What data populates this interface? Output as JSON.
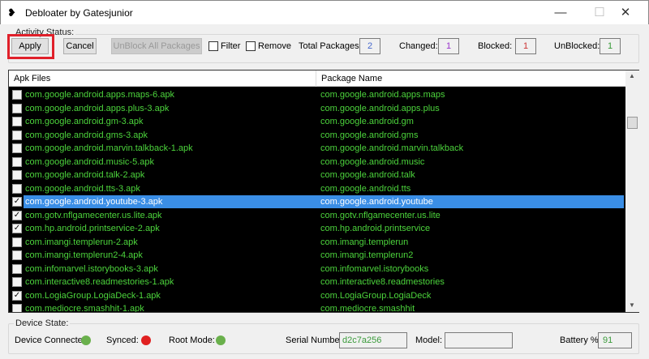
{
  "window": {
    "title": "Debloater by Gatesjunior",
    "minimize": "—",
    "maximize": "☐",
    "close": "✕"
  },
  "activity": {
    "legend": "Activity Status:",
    "apply": "Apply",
    "cancel": "Cancel",
    "unblock_all": "UnBlock All Packages",
    "filter": "Filter",
    "remove": "Remove",
    "filter_checked": false,
    "remove_checked": false,
    "total_label": "Total Packages:",
    "total": "2",
    "changed_label": "Changed:",
    "changed": "1",
    "blocked_label": "Blocked:",
    "blocked": "1",
    "unblocked_label": "UnBlocked:",
    "unblocked": "1"
  },
  "list": {
    "headers": [
      "Apk Files",
      "Package Name"
    ],
    "rows": [
      {
        "apk": "com.google.android.apps.maps-6.apk",
        "pkg": "com.google.android.apps.maps",
        "checked": false
      },
      {
        "apk": "com.google.android.apps.plus-3.apk",
        "pkg": "com.google.android.apps.plus",
        "checked": false
      },
      {
        "apk": "com.google.android.gm-3.apk",
        "pkg": "com.google.android.gm",
        "checked": false
      },
      {
        "apk": "com.google.android.gms-3.apk",
        "pkg": "com.google.android.gms",
        "checked": false
      },
      {
        "apk": "com.google.android.marvin.talkback-1.apk",
        "pkg": "com.google.android.marvin.talkback",
        "checked": false
      },
      {
        "apk": "com.google.android.music-5.apk",
        "pkg": "com.google.android.music",
        "checked": false
      },
      {
        "apk": "com.google.android.talk-2.apk",
        "pkg": "com.google.android.talk",
        "checked": false
      },
      {
        "apk": "com.google.android.tts-3.apk",
        "pkg": "com.google.android.tts",
        "checked": false
      },
      {
        "apk": "com.google.android.youtube-3.apk",
        "pkg": "com.google.android.youtube",
        "checked": true,
        "selected": true
      },
      {
        "apk": "com.gotv.nflgamecenter.us.lite.apk",
        "pkg": "com.gotv.nflgamecenter.us.lite",
        "checked": true
      },
      {
        "apk": "com.hp.android.printservice-2.apk",
        "pkg": "com.hp.android.printservice",
        "checked": true
      },
      {
        "apk": "com.imangi.templerun-2.apk",
        "pkg": "com.imangi.templerun",
        "checked": false
      },
      {
        "apk": "com.imangi.templerun2-4.apk",
        "pkg": "com.imangi.templerun2",
        "checked": false
      },
      {
        "apk": "com.infomarvel.istorybooks-3.apk",
        "pkg": "com.infomarvel.istorybooks",
        "checked": false
      },
      {
        "apk": "com.interactive8.readmestories-1.apk",
        "pkg": "com.interactive8.readmestories",
        "checked": false
      },
      {
        "apk": "com.LogiaGroup.LogiaDeck-1.apk",
        "pkg": "com.LogiaGroup.LogiaDeck",
        "checked": true
      },
      {
        "apk": "com.mediocre.smashhit-1.apk",
        "pkg": "com.mediocre.smashhit",
        "checked": false
      }
    ]
  },
  "device": {
    "legend": "Device State:",
    "connected_label": "Device Connected:",
    "synced_label": "Synced:",
    "root_label": "Root Mode:",
    "connected_color": "#6ab04c",
    "synced_color": "#e02020",
    "root_color": "#6ab04c",
    "serial_label": "Serial Number:",
    "serial": "d2c7a256",
    "model_label": "Model:",
    "model": "",
    "battery_label": "Battery %:",
    "battery": "91"
  },
  "colors": {
    "list_text": "#4cd43c",
    "selection": "#3a8ee6",
    "highlight_box": "#e0202a"
  }
}
